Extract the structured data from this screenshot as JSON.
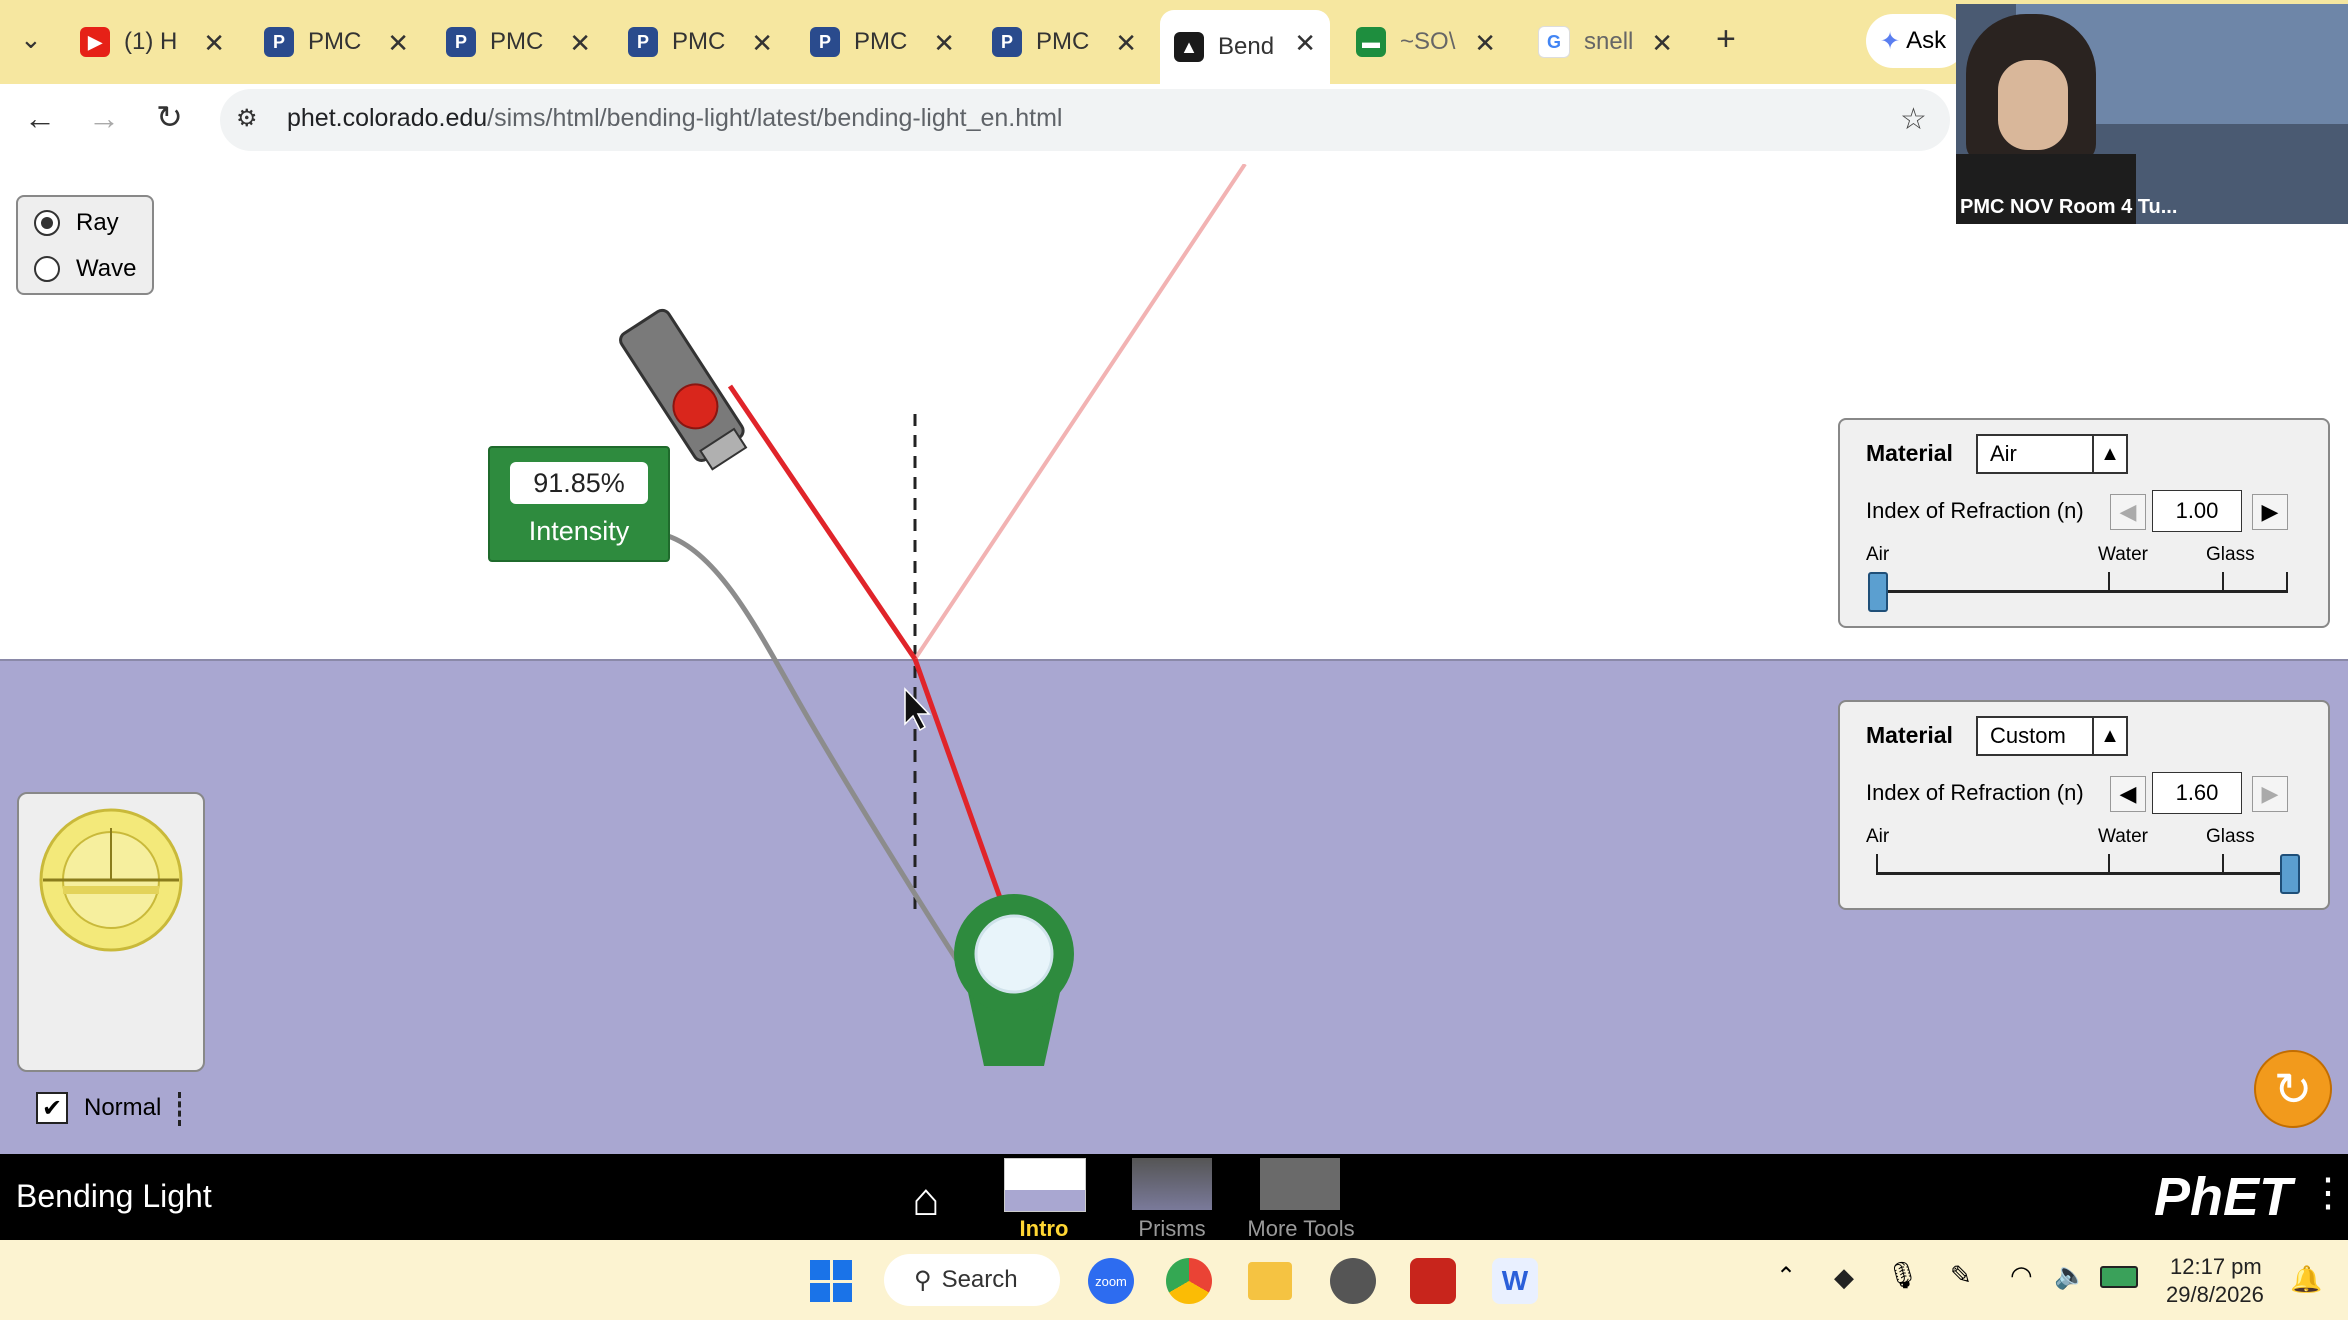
{
  "browser": {
    "tabs": [
      {
        "label": "(1) H",
        "icon": "youtube-icon",
        "color": "#e62117"
      },
      {
        "label": "PMC",
        "icon": "pmc-icon",
        "color": "#2a4b8d"
      },
      {
        "label": "PMC",
        "icon": "pmc-icon",
        "color": "#2a4b8d"
      },
      {
        "label": "PMC",
        "icon": "pmc-icon",
        "color": "#2a4b8d"
      },
      {
        "label": "PMC",
        "icon": "pmc-icon",
        "color": "#2a4b8d"
      },
      {
        "label": "PMC",
        "icon": "pmc-icon",
        "color": "#2a4b8d"
      },
      {
        "label": "Bend",
        "icon": "phet-icon",
        "color": "#1a1a1a",
        "active": true
      },
      {
        "label": "~SO\\",
        "icon": "sheets-icon",
        "color": "#1e8e3e"
      },
      {
        "label": "snell",
        "icon": "google-icon",
        "color": "#4285f4"
      }
    ],
    "ask_label": "Ask",
    "url_host": "phet.colorado.edu",
    "url_path": "/sims/html/bending-light/latest/bending-light_en.html"
  },
  "video": {
    "caption": "PMC NOV Room 4 Tu..."
  },
  "sim": {
    "mode_options": [
      {
        "label": "Ray",
        "selected": true
      },
      {
        "label": "Wave",
        "selected": false
      }
    ],
    "intensity_value": "91.85%",
    "intensity_label": "Intensity",
    "top_material": {
      "title": "Material",
      "selected": "Air",
      "index_label": "Index of Refraction (n)",
      "index_value": "1.00",
      "slider_labels": [
        "Air",
        "Water",
        "Glass"
      ],
      "slider_level": 0.0
    },
    "bottom_material": {
      "title": "Material",
      "selected": "Custom",
      "index_label": "Index of Refraction (n)",
      "index_value": "1.60",
      "slider_labels": [
        "Air",
        "Water",
        "Glass"
      ],
      "slider_level": 1.0
    },
    "normal_label": "Normal",
    "normal_checked": true,
    "colors": {
      "top_medium": "#ffffff",
      "bottom_medium": "#a9a7d1",
      "ray": "#e0242a",
      "reflected_ray": "#f2b3b3"
    }
  },
  "navbar": {
    "title": "Bending Light",
    "screens": [
      {
        "label": "Intro",
        "selected": true
      },
      {
        "label": "Prisms",
        "selected": false
      },
      {
        "label": "More Tools",
        "selected": false
      }
    ],
    "brand": "PhET"
  },
  "taskbar": {
    "search_label": "Search",
    "time": "12:17 pm",
    "date": "29/8/2026"
  }
}
